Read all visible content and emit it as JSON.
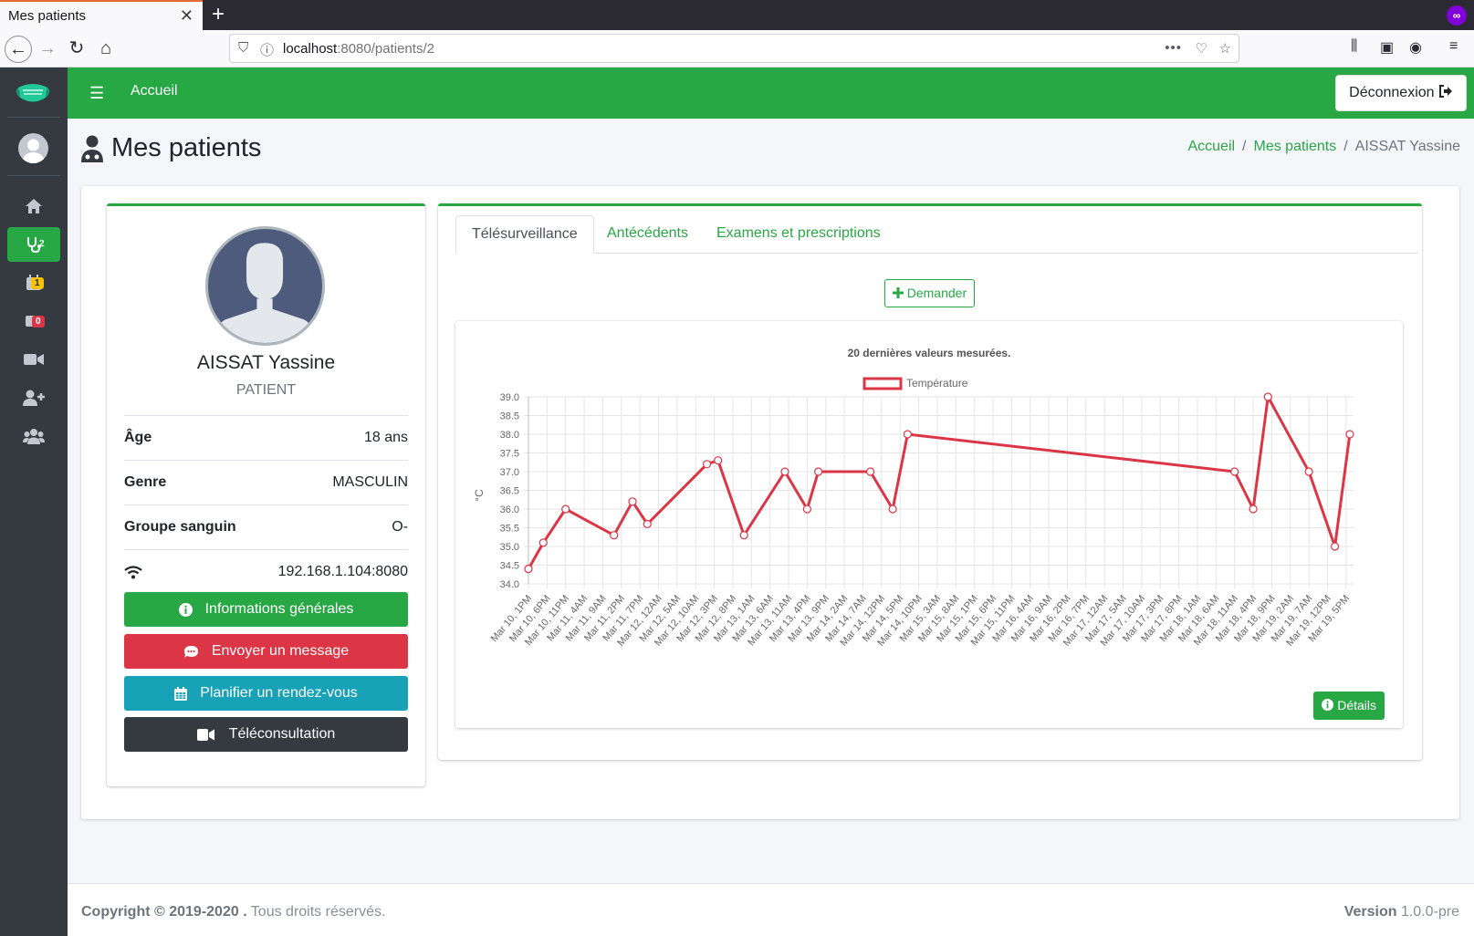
{
  "browser": {
    "tab_title": "Mes patients",
    "url_host": "localhost",
    "url_path": ":8080/patients/2"
  },
  "topnav": {
    "home_label": "Accueil",
    "logout_label": "Déconnexion"
  },
  "sidebar": {
    "items": [
      {
        "icon": "home-icon"
      },
      {
        "icon": "stethoscope-icon",
        "badge": "2",
        "active": true
      },
      {
        "icon": "calendar-icon",
        "badge": "1",
        "badge_color": "#ffc107"
      },
      {
        "icon": "video-slash-icon",
        "badge": "0",
        "badge_color": "#dc3545"
      },
      {
        "icon": "video-icon"
      },
      {
        "icon": "user-plus-icon"
      },
      {
        "icon": "users-icon"
      }
    ]
  },
  "header": {
    "title": "Mes patients",
    "breadcrumb": [
      "Accueil",
      "Mes patients",
      "AISSAT Yassine"
    ]
  },
  "profile": {
    "name": "AISSAT Yassine",
    "role": "PATIENT",
    "rows": [
      {
        "label": "Âge",
        "value": "18 ans"
      },
      {
        "label": "Genre",
        "value": "MASCULIN"
      },
      {
        "label": "Groupe sanguin",
        "value": "O-"
      },
      {
        "label_icon": "wifi-icon",
        "value": "192.168.1.104:8080"
      }
    ],
    "buttons": {
      "info": "Informations générales",
      "message": "Envoyer un message",
      "appointment": "Planifier un rendez-vous",
      "teleconsult": "Téléconsultation"
    }
  },
  "tabs": [
    "Télésurveillance",
    "Antécédents",
    "Examens et prescriptions"
  ],
  "demander_label": "Demander",
  "details_label": "Détails",
  "chart_data": {
    "type": "line",
    "title": "20 dernières valeurs mesurées.",
    "ylabel": "°C",
    "ylim": [
      34.0,
      39.0
    ],
    "yticks": [
      "34.0",
      "34.5",
      "35.0",
      "35.5",
      "36.0",
      "36.5",
      "37.0",
      "37.5",
      "38.0",
      "38.5",
      "39.0"
    ],
    "legend_position": "top",
    "grid": true,
    "series": [
      {
        "name": "Température",
        "color": "#dc3545"
      }
    ],
    "x_labels": [
      "Mar 10, 1PM",
      "Mar 10, 6PM",
      "Mar 10, 11PM",
      "Mar 11, 4AM",
      "Mar 11, 9AM",
      "Mar 11, 2PM",
      "Mar 11, 7PM",
      "Mar 12, 12AM",
      "Mar 12, 5AM",
      "Mar 12, 10AM",
      "Mar 12, 3PM",
      "Mar 12, 8PM",
      "Mar 13, 1AM",
      "Mar 13, 6AM",
      "Mar 13, 11AM",
      "Mar 13, 4PM",
      "Mar 13, 9PM",
      "Mar 14, 2AM",
      "Mar 14, 7AM",
      "Mar 14, 12PM",
      "Mar 14, 5PM",
      "Mar 14, 10PM",
      "Mar 15, 3AM",
      "Mar 15, 8AM",
      "Mar 15, 1PM",
      "Mar 15, 6PM",
      "Mar 15, 11PM",
      "Mar 16, 4AM",
      "Mar 16, 9AM",
      "Mar 16, 2PM",
      "Mar 16, 7PM",
      "Mar 17, 12AM",
      "Mar 17, 5AM",
      "Mar 17, 10AM",
      "Mar 17, 3PM",
      "Mar 17, 8PM",
      "Mar 18, 1AM",
      "Mar 18, 6AM",
      "Mar 18, 11AM",
      "Mar 18, 4PM",
      "Mar 18, 9PM",
      "Mar 19, 2AM",
      "Mar 19, 7AM",
      "Mar 19, 12PM",
      "Mar 19, 5PM"
    ],
    "points": [
      {
        "x": "Mar 10, 1PM",
        "y": 34.4
      },
      {
        "x": "Mar 10, 5PM",
        "y": 35.1
      },
      {
        "x": "Mar 10, 11PM",
        "y": 36.0
      },
      {
        "x": "Mar 11, 12PM",
        "y": 35.3
      },
      {
        "x": "Mar 11, 5PM",
        "y": 36.2
      },
      {
        "x": "Mar 11, 9PM",
        "y": 35.6
      },
      {
        "x": "Mar 12, 1PM",
        "y": 37.2
      },
      {
        "x": "Mar 12, 4PM",
        "y": 37.3
      },
      {
        "x": "Mar 12, 11PM",
        "y": 35.3
      },
      {
        "x": "Mar 13, 10AM",
        "y": 37.0
      },
      {
        "x": "Mar 13, 4PM",
        "y": 36.0
      },
      {
        "x": "Mar 13, 7PM",
        "y": 37.0
      },
      {
        "x": "Mar 14, 9AM",
        "y": 37.0
      },
      {
        "x": "Mar 14, 3PM",
        "y": 36.0
      },
      {
        "x": "Mar 14, 7PM",
        "y": 38.0
      },
      {
        "x": "Mar 18, 11AM",
        "y": 37.0
      },
      {
        "x": "Mar 18, 4PM",
        "y": 36.0
      },
      {
        "x": "Mar 18, 8PM",
        "y": 39.0
      },
      {
        "x": "Mar 19, 7AM",
        "y": 37.0
      },
      {
        "x": "Mar 19, 2PM",
        "y": 35.0
      },
      {
        "x": "Mar 19, 6PM",
        "y": 38.0
      }
    ]
  },
  "footer": {
    "copyright": "Copyright © 2019-2020 .",
    "rights": "Tous droits réservés.",
    "version_label": "Version",
    "version": "1.0.0-pre"
  }
}
